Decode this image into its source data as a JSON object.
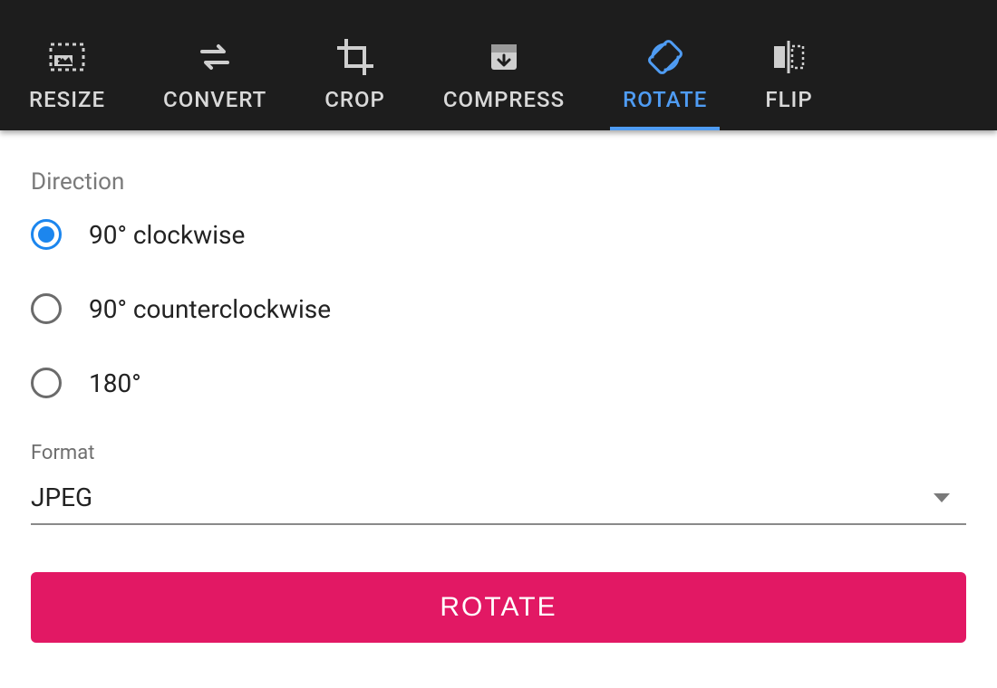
{
  "tabs": [
    {
      "id": "resize",
      "label": "RESIZE",
      "active": false
    },
    {
      "id": "convert",
      "label": "CONVERT",
      "active": false
    },
    {
      "id": "crop",
      "label": "CROP",
      "active": false
    },
    {
      "id": "compress",
      "label": "COMPRESS",
      "active": false
    },
    {
      "id": "rotate",
      "label": "ROTATE",
      "active": true
    },
    {
      "id": "flip",
      "label": "FLIP",
      "active": false
    }
  ],
  "direction": {
    "label": "Direction",
    "options": [
      {
        "id": "cw90",
        "label": "90° clockwise",
        "selected": true
      },
      {
        "id": "ccw90",
        "label": "90° counterclockwise",
        "selected": false
      },
      {
        "id": "r180",
        "label": "180°",
        "selected": false
      }
    ]
  },
  "format": {
    "label": "Format",
    "value": "JPEG"
  },
  "action_button": "ROTATE",
  "colors": {
    "accent": "#4f9cf3",
    "primary": "#e21864",
    "toolbar_bg": "#1d1d1d"
  }
}
